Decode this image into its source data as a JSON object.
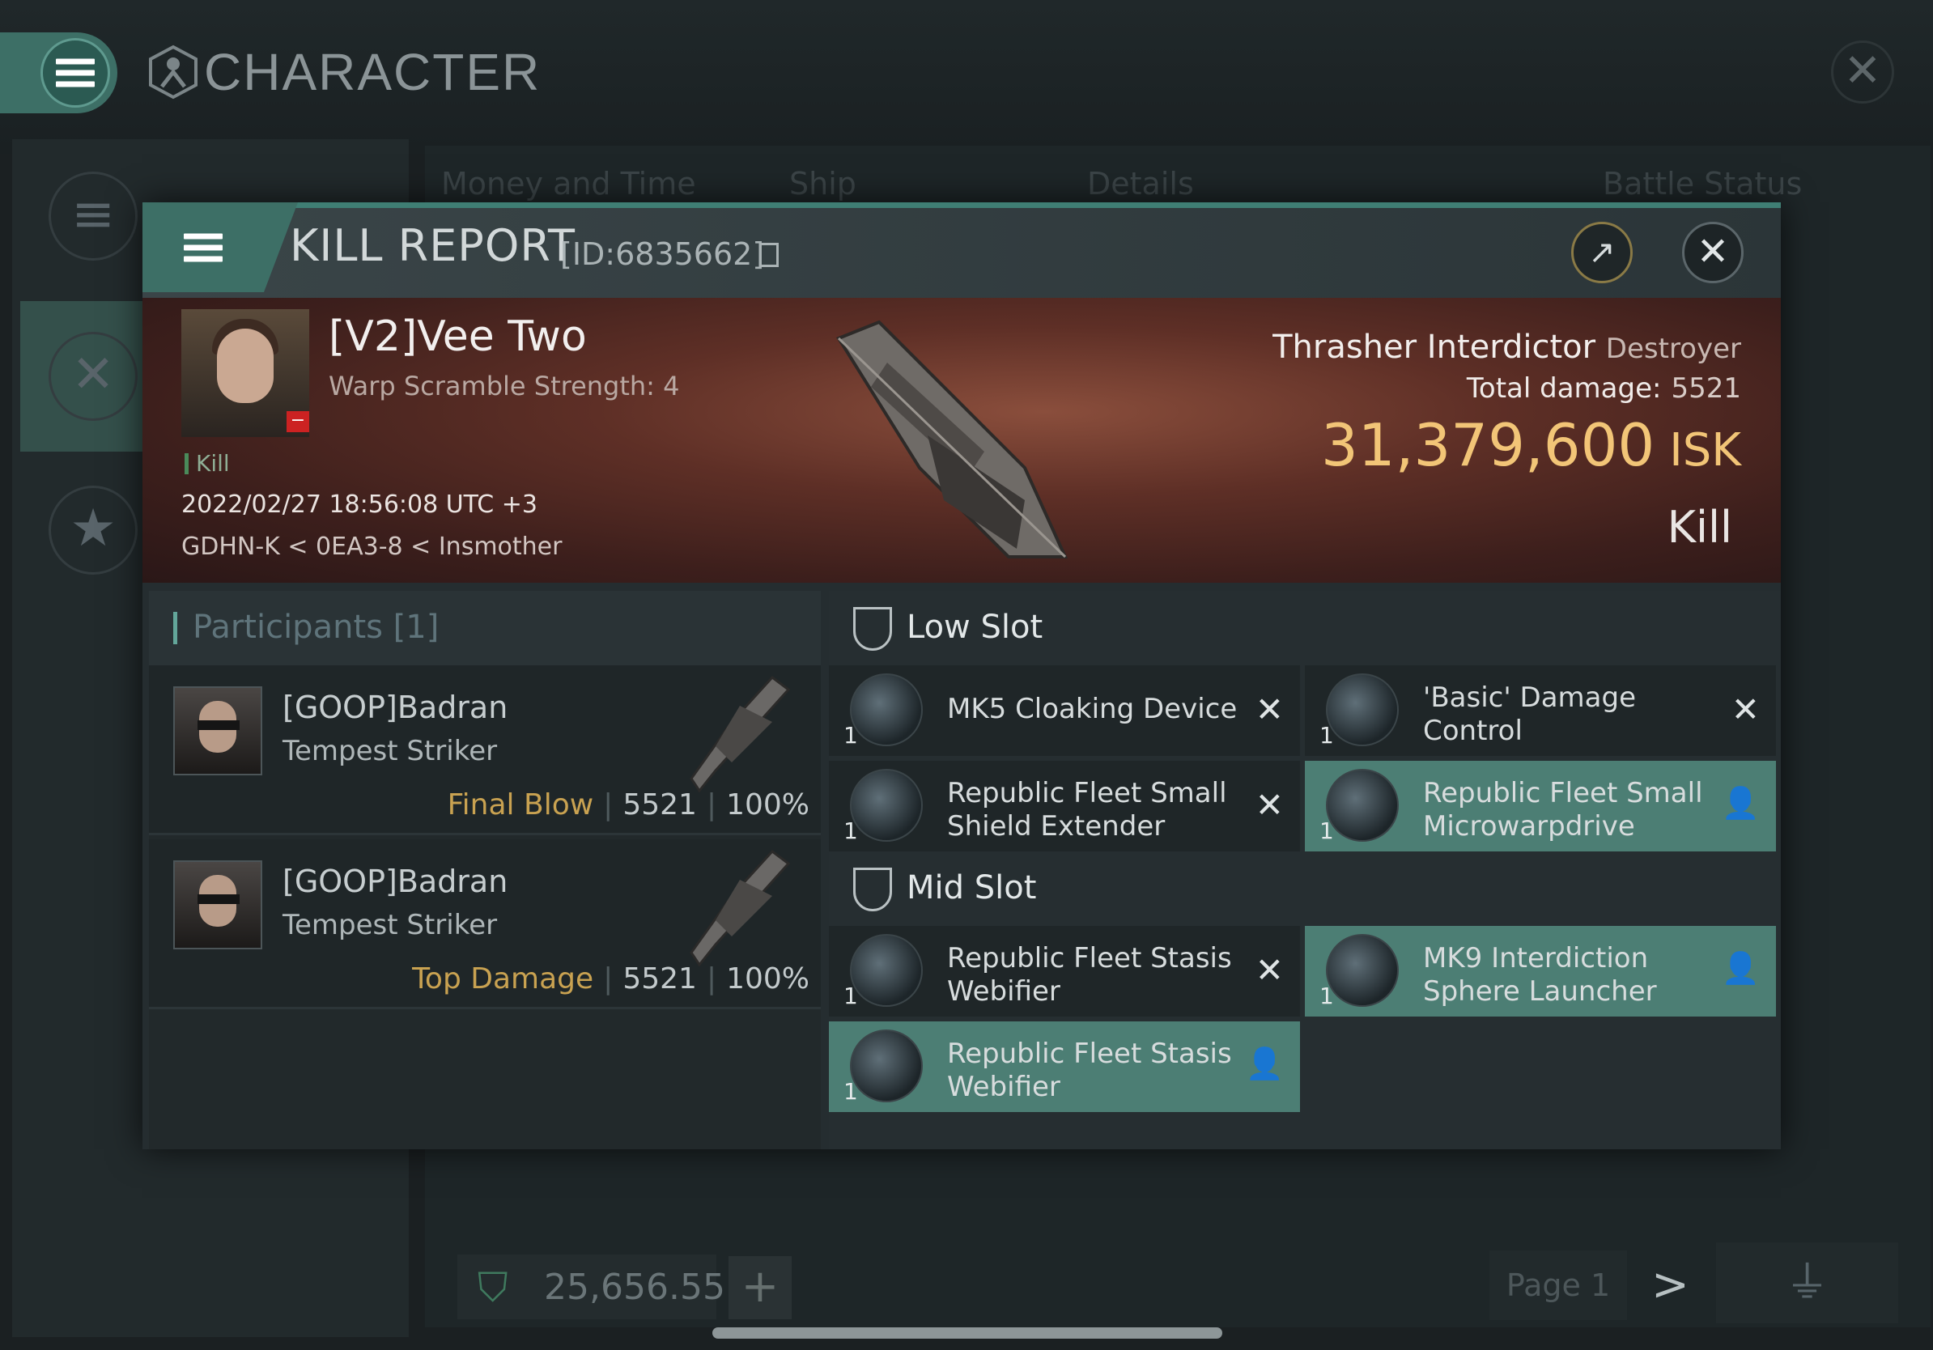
{
  "window": {
    "title": "CHARACTER",
    "tabs": [
      "Money and Time",
      "Ship",
      "Details",
      "Battle Status"
    ],
    "isk_balance": "25,656.55",
    "page": "Page 1"
  },
  "kill_report": {
    "title": "KILL REPORT",
    "id": "[ID:6835662]",
    "victim": {
      "name": "[V2]Vee Two",
      "subtitle": "Warp Scramble Strength: 4",
      "tag": "Kill",
      "datetime": "2022/02/27 18:56:08 UTC +3",
      "location": "GDHN-K < 0EA3-8 < Insmother"
    },
    "ship": {
      "name": "Thrasher Interdictor",
      "class": "Destroyer",
      "total_damage_label": "Total damage:",
      "total_damage": "5521",
      "value": "31,379,600",
      "value_unit": "ISK",
      "result": "Kill"
    },
    "participants": {
      "title": "Participants [1]",
      "rows": [
        {
          "name": "[GOOP]Badran",
          "ship": "Tempest Striker",
          "tag": "Final Blow",
          "damage": "5521",
          "percent": "100%"
        },
        {
          "name": "[GOOP]Badran",
          "ship": "Tempest Striker",
          "tag": "Top Damage",
          "damage": "5521",
          "percent": "100%"
        }
      ]
    },
    "low_slot": {
      "label": "Low Slot",
      "modules": [
        {
          "name": "MK5 Cloaking Device",
          "qty": "1",
          "status": "destroyed"
        },
        {
          "name": "'Basic' Damage Control",
          "qty": "1",
          "status": "destroyed"
        },
        {
          "name": "Republic Fleet Small Shield Extender",
          "qty": "1",
          "status": "destroyed"
        },
        {
          "name": "Republic Fleet Small Microwarpdrive",
          "qty": "1",
          "status": "dropped"
        }
      ]
    },
    "mid_slot": {
      "label": "Mid Slot",
      "modules": [
        {
          "name": "Republic Fleet Stasis Webifier",
          "qty": "1",
          "status": "destroyed"
        },
        {
          "name": "MK9 Interdiction Sphere Launcher",
          "qty": "1",
          "status": "dropped"
        },
        {
          "name": "Republic Fleet Stasis Webifier",
          "qty": "1",
          "status": "dropped"
        }
      ]
    }
  }
}
